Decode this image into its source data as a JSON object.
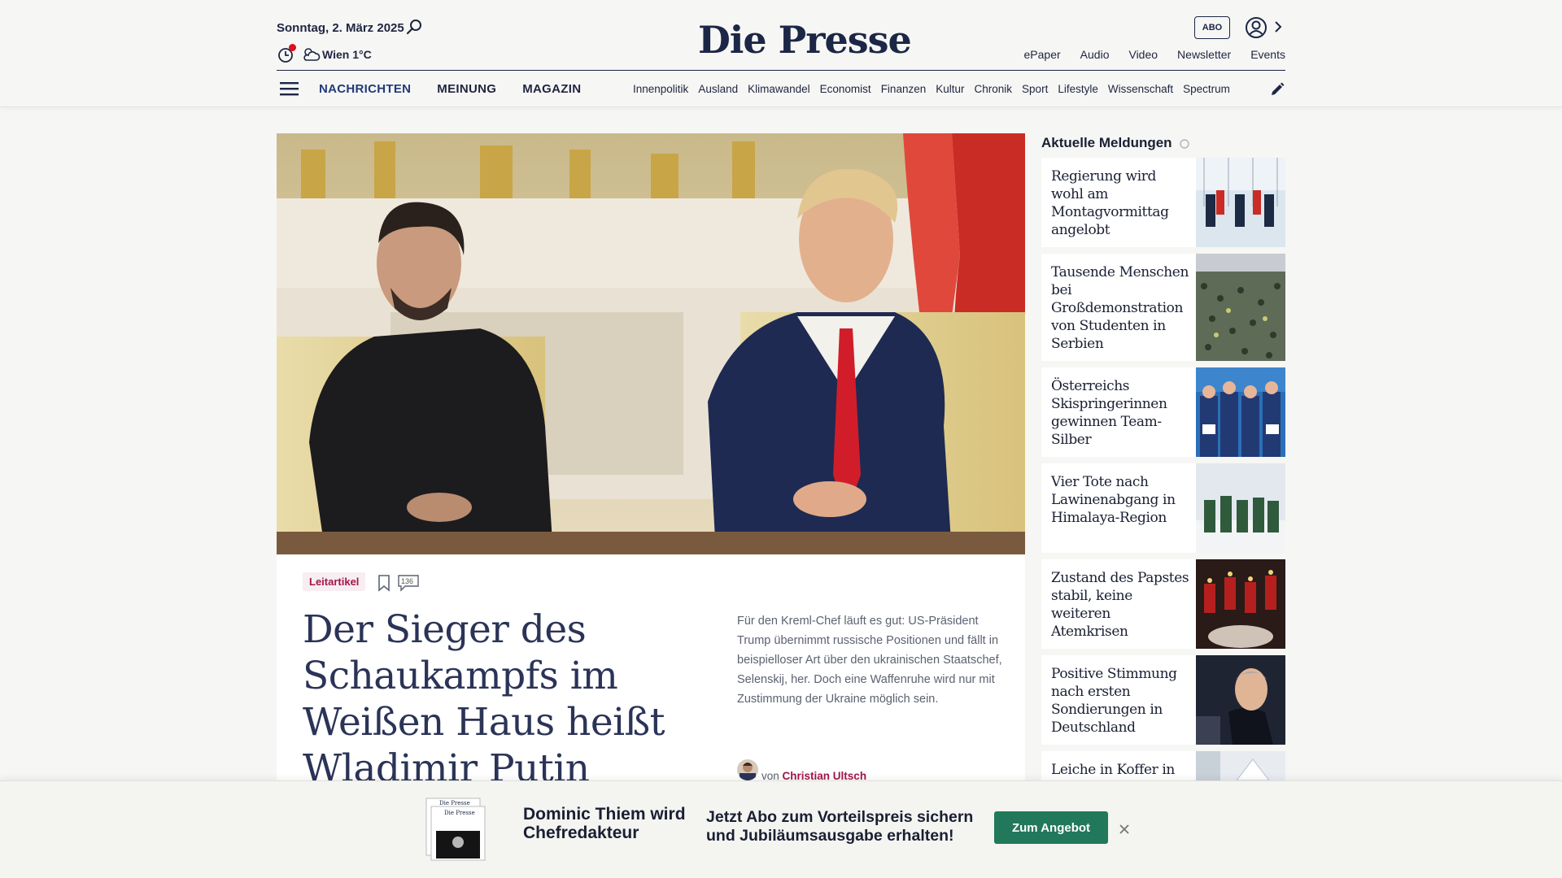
{
  "header": {
    "date": "Sonntag, 2. März 2025",
    "weather": "Wien 1°C",
    "logo": "Die Presse",
    "abo_label": "ABO",
    "top_links": [
      "ePaper",
      "Audio",
      "Video",
      "Newsletter",
      "Events"
    ]
  },
  "nav": {
    "main": [
      "NACHRICHTEN",
      "MEINUNG",
      "MAGAZIN"
    ],
    "sub": [
      "Innenpolitik",
      "Ausland",
      "Klimawandel",
      "Economist",
      "Finanzen",
      "Kultur",
      "Chronik",
      "Sport",
      "Lifestyle",
      "Wissenschaft",
      "Spectrum"
    ]
  },
  "article": {
    "tag": "Leitartikel",
    "comment_count": "136",
    "headline": "Der Sieger des Schaukampfs im Weißen Haus heißt Wladimir Putin",
    "teaser": "Für den Kreml-Chef läuft es gut: US-Präsident Trump übernimmt russische Positionen und fällt in beispielloser Art über den ukrainischen Staatschef, Selenskij, her. Doch eine Waffenruhe wird nur mit Zustimmung der Ukraine möglich sein.",
    "author_prefix": "von",
    "author": "Christian Ultsch"
  },
  "sidebar": {
    "title": "Aktuelle Meldungen",
    "items": [
      {
        "title": "Regierung wird wohl am Montagvormittag angelobt"
      },
      {
        "title": "Tausende Menschen bei Großdemonstration von Studenten in Serbien"
      },
      {
        "title": "Österreichs Skispringerinnen gewinnen Team-Silber"
      },
      {
        "title": "Vier Tote nach Lawinenabgang in Himalaya-Region"
      },
      {
        "title": "Zustand des Papstes stabil, keine weiteren Atemkrisen"
      },
      {
        "title": "Positive Stimmung nach ersten Sondierungen in Deutschland"
      },
      {
        "title": "Leiche in Koffer in"
      }
    ]
  },
  "banner": {
    "name": "Dominic Thiem wird Chefredakteur",
    "offer": "Jetzt Abo zum Vorteilspreis sichern und Jubiläumsausgabe erhalten!",
    "cta": "Zum Angebot",
    "paper_logo": "Die Presse"
  },
  "colors": {
    "brand_navy": "#1c2646",
    "accent_magenta": "#a3164a",
    "cta_green": "#21785a",
    "alert_red": "#e00d1f"
  }
}
